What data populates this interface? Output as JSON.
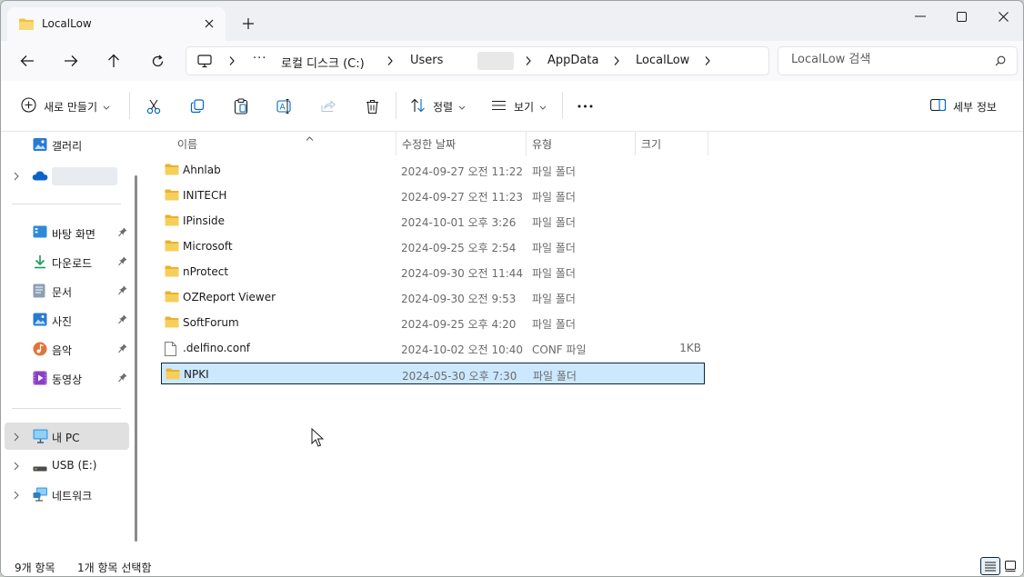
{
  "tab": {
    "title": "LocalLow"
  },
  "breadcrumb": {
    "overflow": "···",
    "items": [
      "로컬 디스크 (C:)",
      "Users",
      "AppData",
      "LocalLow"
    ]
  },
  "search": {
    "placeholder": "LocalLow 검색"
  },
  "toolbar": {
    "new_label": "새로 만들기",
    "sort_label": "정렬",
    "view_label": "보기",
    "more_label": "···",
    "details_label": "세부 정보"
  },
  "sidebar": {
    "gallery": "갤러리",
    "quick": [
      {
        "label": "바탕 화면",
        "icon": "desktop-icon"
      },
      {
        "label": "다운로드",
        "icon": "download-icon"
      },
      {
        "label": "문서",
        "icon": "documents-icon"
      },
      {
        "label": "사진",
        "icon": "pictures-icon"
      },
      {
        "label": "음악",
        "icon": "music-icon"
      },
      {
        "label": "동영상",
        "icon": "videos-icon"
      }
    ],
    "this_pc": "내 PC",
    "usb": "USB (E:)",
    "network": "네트워크"
  },
  "columns": {
    "name": "이름",
    "date": "수정한 날짜",
    "type": "유형",
    "size": "크기"
  },
  "files": [
    {
      "name": "Ahnlab",
      "date": "2024-09-27 오전 11:22",
      "type": "파일 폴더",
      "size": "",
      "kind": "folder"
    },
    {
      "name": "INITECH",
      "date": "2024-09-27 오전 11:23",
      "type": "파일 폴더",
      "size": "",
      "kind": "folder"
    },
    {
      "name": "IPinside",
      "date": "2024-10-01 오후 3:26",
      "type": "파일 폴더",
      "size": "",
      "kind": "folder"
    },
    {
      "name": "Microsoft",
      "date": "2024-09-25 오후 2:54",
      "type": "파일 폴더",
      "size": "",
      "kind": "folder"
    },
    {
      "name": "nProtect",
      "date": "2024-09-30 오전 11:44",
      "type": "파일 폴더",
      "size": "",
      "kind": "folder"
    },
    {
      "name": "OZReport Viewer",
      "date": "2024-09-30 오전 9:53",
      "type": "파일 폴더",
      "size": "",
      "kind": "folder"
    },
    {
      "name": "SoftForum",
      "date": "2024-09-25 오후 4:20",
      "type": "파일 폴더",
      "size": "",
      "kind": "folder"
    },
    {
      "name": ".delfino.conf",
      "date": "2024-10-02 오전 10:40",
      "type": "CONF 파일",
      "size": "1KB",
      "kind": "file"
    },
    {
      "name": "NPKI",
      "date": "2024-05-30 오후 7:30",
      "type": "파일 폴더",
      "size": "",
      "kind": "folder",
      "selected": true
    }
  ],
  "status": {
    "count": "9개 항목",
    "selection": "1개 항목 선택함"
  },
  "colors": {
    "accent": "#0067c0",
    "folder": "#f4c13d",
    "selection": "#cce8ff"
  }
}
